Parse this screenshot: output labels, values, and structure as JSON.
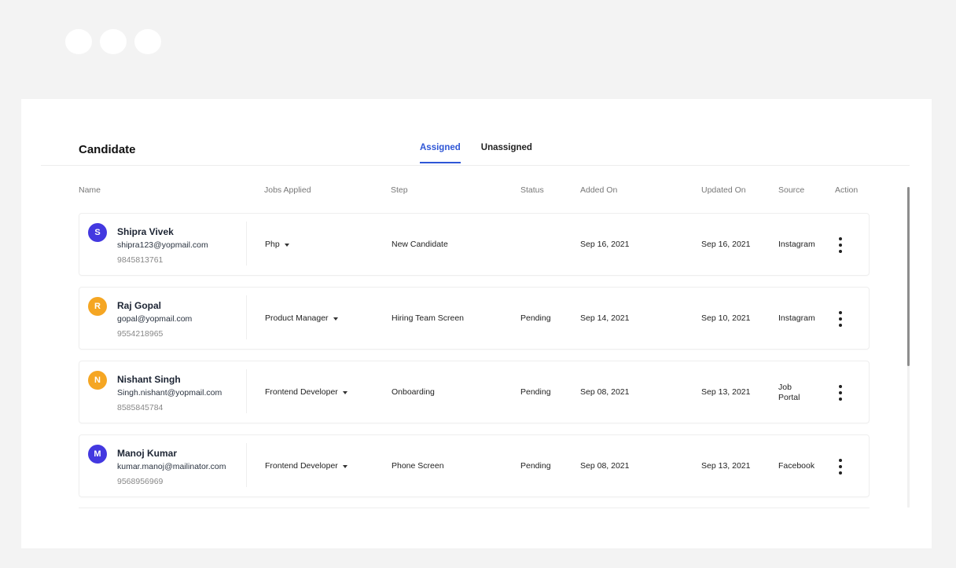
{
  "window": {
    "traffic_lights": [
      "dot",
      "dot",
      "dot"
    ]
  },
  "page": {
    "title": "Candidate"
  },
  "tabs": [
    {
      "label": "Assigned",
      "active": true
    },
    {
      "label": "Unassigned",
      "active": false
    }
  ],
  "columns": {
    "name": "Name",
    "jobs_applied": "Jobs Applied",
    "step": "Step",
    "status": "Status",
    "added_on": "Added On",
    "updated_on": "Updated On",
    "source": "Source",
    "action": "Action"
  },
  "colors": {
    "accent": "#2e56d6",
    "avatar_purple": "#4338e0",
    "avatar_orange": "#f5a623"
  },
  "rows": [
    {
      "initial": "S",
      "avatar_color": "#4338e0",
      "name": "Shipra Vivek",
      "email": "shipra123@yopmail.com",
      "phone": "9845813761",
      "job": "Php",
      "step": "New Candidate",
      "status": "",
      "added_on": "Sep 16, 2021",
      "updated_on": "Sep 16, 2021",
      "source_line1": "Instagram",
      "source_line2": ""
    },
    {
      "initial": "R",
      "avatar_color": "#f5a623",
      "name": "Raj Gopal",
      "email": "gopal@yopmail.com",
      "phone": "9554218965",
      "job": "Product Manager",
      "step": "Hiring Team Screen",
      "status": "Pending",
      "added_on": "Sep 14, 2021",
      "updated_on": "Sep 10, 2021",
      "source_line1": "Instagram",
      "source_line2": ""
    },
    {
      "initial": "N",
      "avatar_color": "#f5a623",
      "name": "Nishant Singh",
      "email": "Singh.nishant@yopmail.com",
      "phone": "8585845784",
      "job": "Frontend Developer",
      "step": "Onboarding",
      "status": "Pending",
      "added_on": "Sep 08, 2021",
      "updated_on": "Sep 13, 2021",
      "source_line1": "Job",
      "source_line2": "Portal"
    },
    {
      "initial": "M",
      "avatar_color": "#4338e0",
      "name": "Manoj Kumar",
      "email": "kumar.manoj@mailinator.com",
      "phone": "9568956969",
      "job": "Frontend Developer",
      "step": "Phone Screen",
      "status": "Pending",
      "added_on": "Sep 08, 2021",
      "updated_on": "Sep 13, 2021",
      "source_line1": "Facebook",
      "source_line2": ""
    }
  ]
}
